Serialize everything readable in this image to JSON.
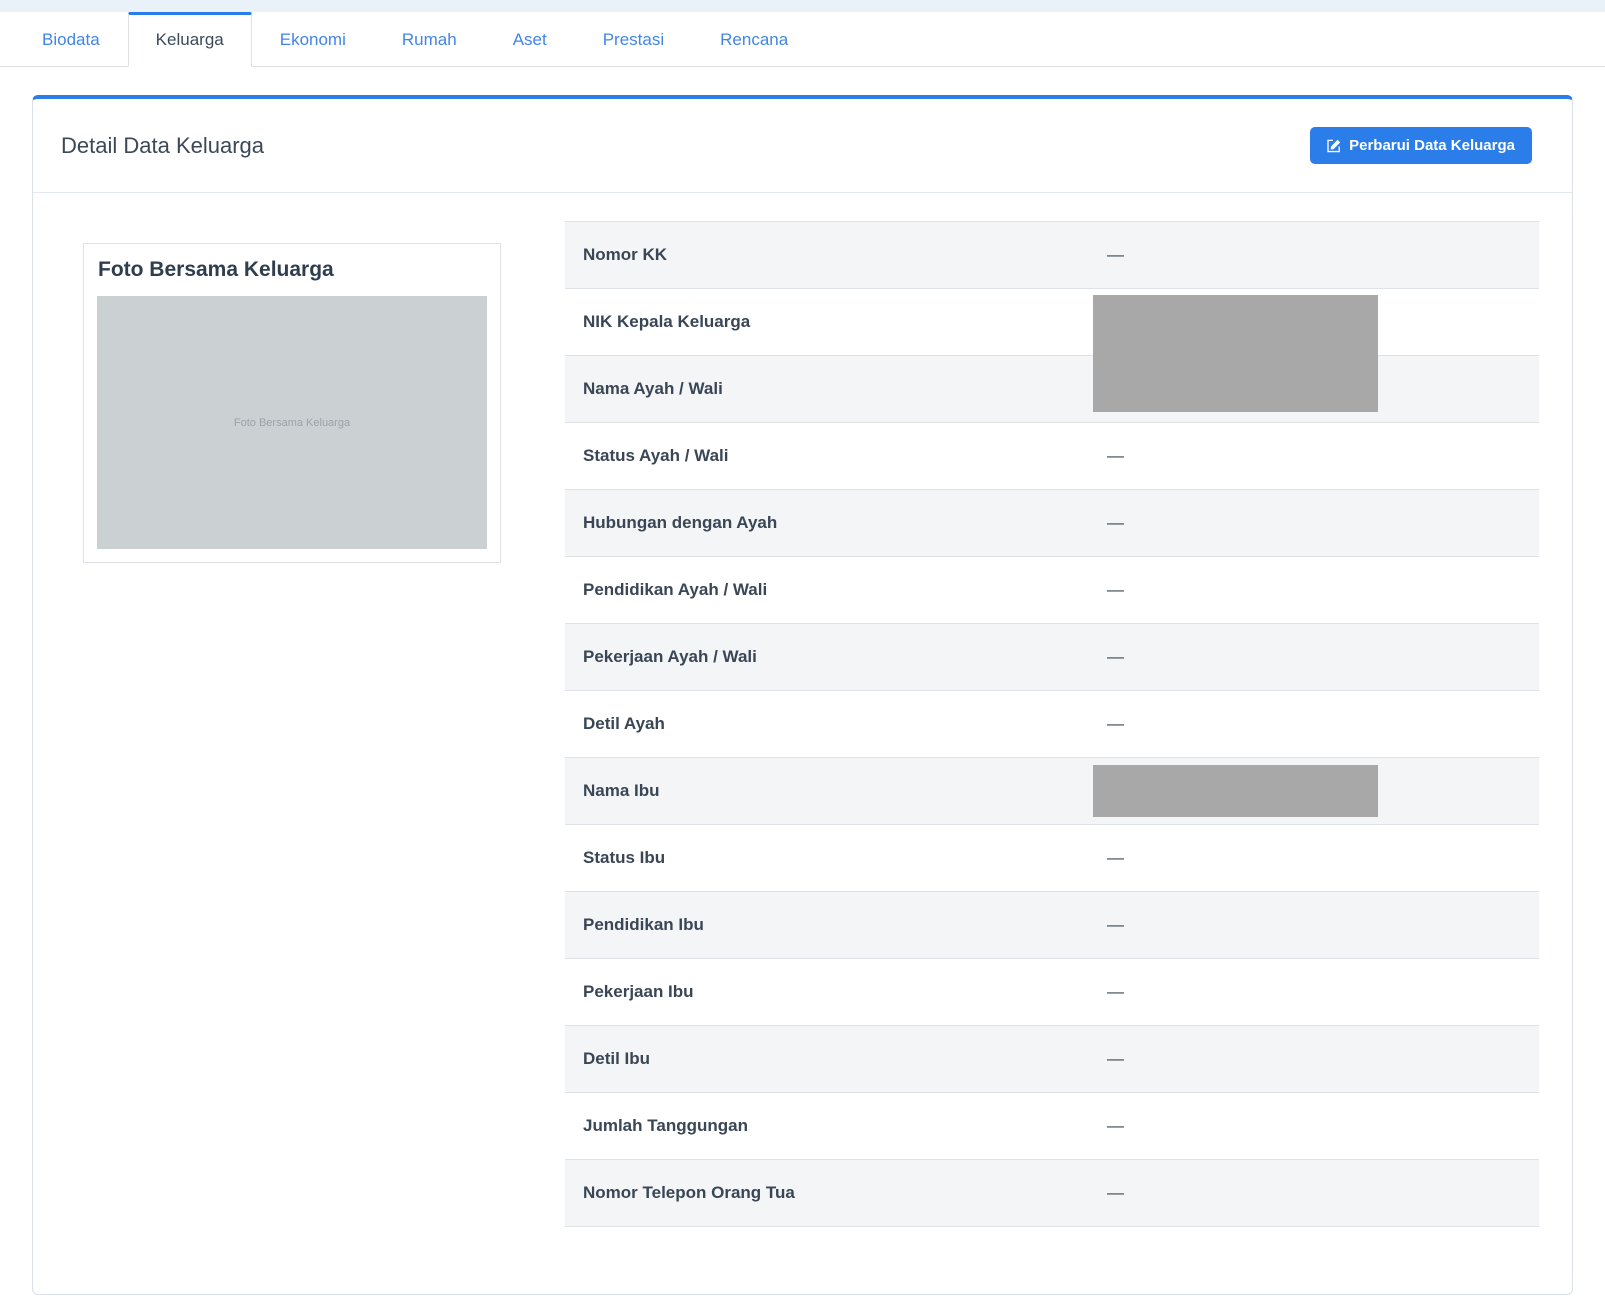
{
  "colors": {
    "accent_blue": "#2b7de9",
    "redact_gray": "#a8a8a8",
    "stripe_gray": "#f3f5f6"
  },
  "tabs": [
    {
      "label": "Biodata",
      "active": false
    },
    {
      "label": "Keluarga",
      "active": true
    },
    {
      "label": "Ekonomi",
      "active": false
    },
    {
      "label": "Rumah",
      "active": false
    },
    {
      "label": "Aset",
      "active": false
    },
    {
      "label": "Prestasi",
      "active": false
    },
    {
      "label": "Rencana",
      "active": false
    }
  ],
  "card": {
    "title": "Detail Data Keluarga",
    "update_button_label": "Perbarui Data Keluarga",
    "update_button_icon": "edit-icon"
  },
  "photo": {
    "title": "Foto Bersama Keluarga",
    "placeholder": "Foto Bersama Keluarga"
  },
  "table": {
    "rows": [
      {
        "label": "Nomor KK",
        "value": "—"
      },
      {
        "label": "NIK Kepala Keluarga",
        "value": "",
        "redacted": true,
        "redact_span": 2
      },
      {
        "label": "Nama Ayah / Wali",
        "value": ""
      },
      {
        "label": "Status Ayah / Wali",
        "value": "—"
      },
      {
        "label": "Hubungan dengan Ayah",
        "value": "—"
      },
      {
        "label": "Pendidikan Ayah / Wali",
        "value": "—"
      },
      {
        "label": "Pekerjaan Ayah / Wali",
        "value": "—"
      },
      {
        "label": "Detil Ayah",
        "value": "—"
      },
      {
        "label": "Nama Ibu",
        "value": "",
        "redacted": true,
        "redact_span": 1
      },
      {
        "label": "Status Ibu",
        "value": "—"
      },
      {
        "label": "Pendidikan Ibu",
        "value": "—"
      },
      {
        "label": "Pekerjaan Ibu",
        "value": "—"
      },
      {
        "label": "Detil Ibu",
        "value": "—"
      },
      {
        "label": "Jumlah Tanggungan",
        "value": "—"
      },
      {
        "label": "Nomor Telepon Orang Tua",
        "value": "—"
      }
    ]
  }
}
